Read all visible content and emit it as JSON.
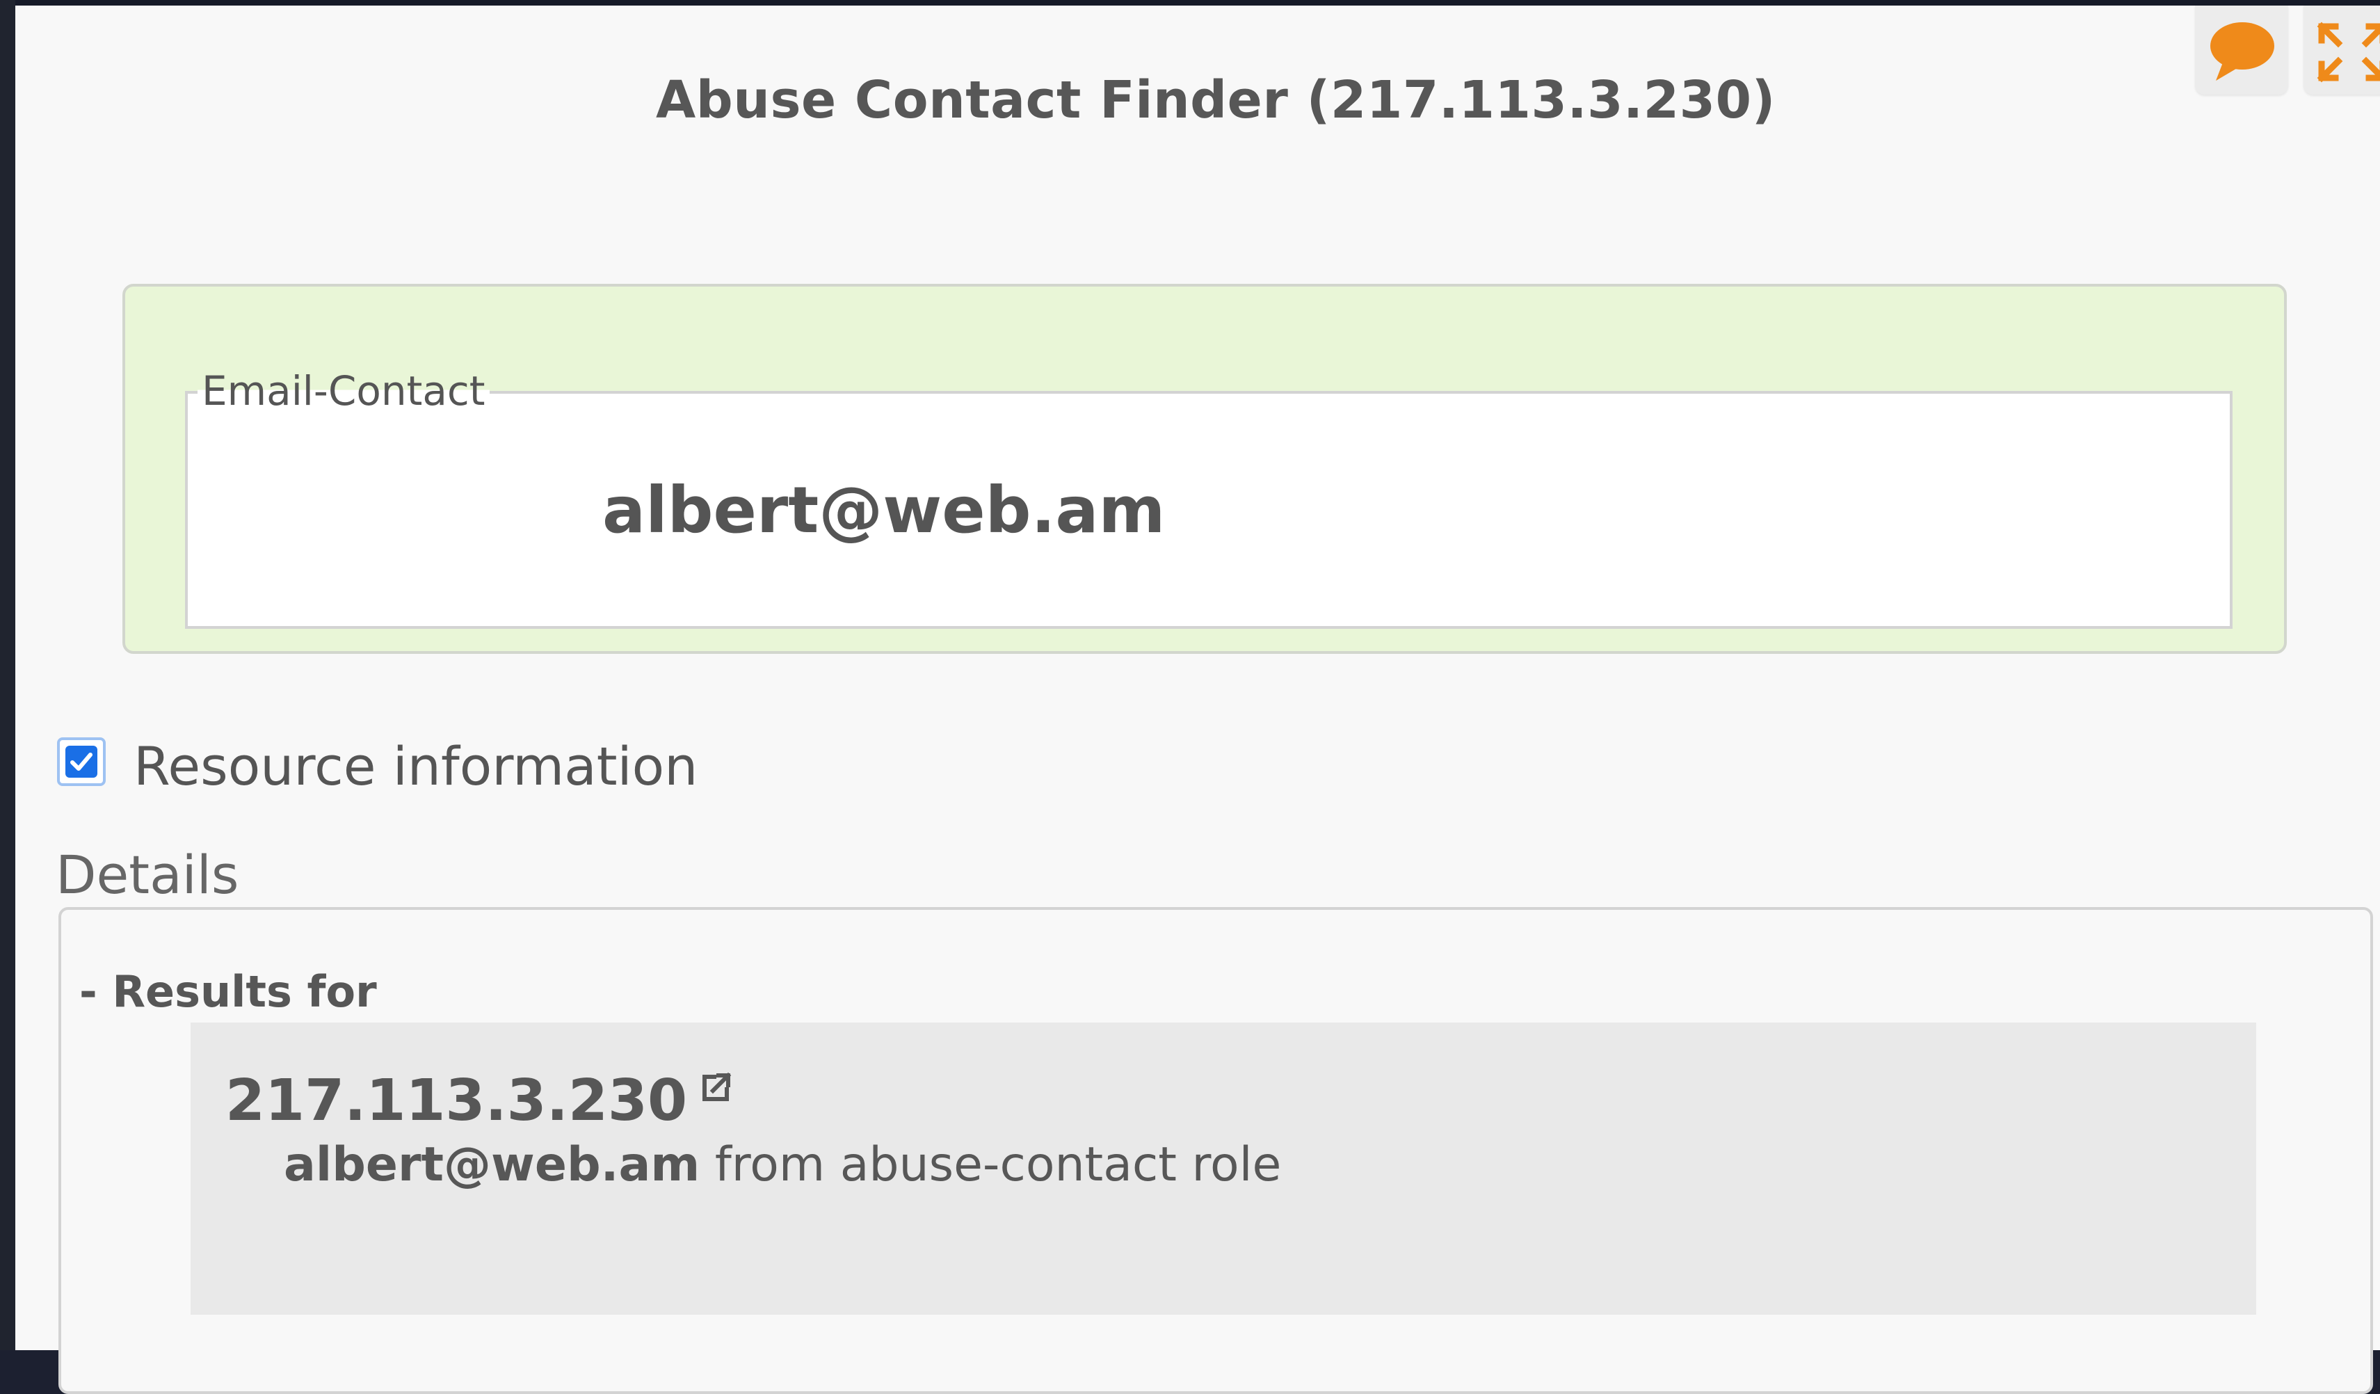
{
  "header": {
    "title": "Abuse Contact Finder (217.113.3.230)",
    "feedback_icon": "speech-bubble-icon",
    "expand_icon": "expand-arrows-icon"
  },
  "contact": {
    "legend": "Email-Contact",
    "email": "albert@web.am"
  },
  "resource": {
    "label": "Resource information",
    "checked": true
  },
  "details": {
    "label": "Details",
    "results_for": "- Results for",
    "result": {
      "ip": "217.113.3.230",
      "email": "albert@web.am",
      "source": "from abuse-contact role"
    }
  },
  "colors": {
    "accent_orange": "#ef8a1a",
    "contact_bg": "#e9f6d7",
    "checkbox_blue": "#1a6fe6"
  }
}
